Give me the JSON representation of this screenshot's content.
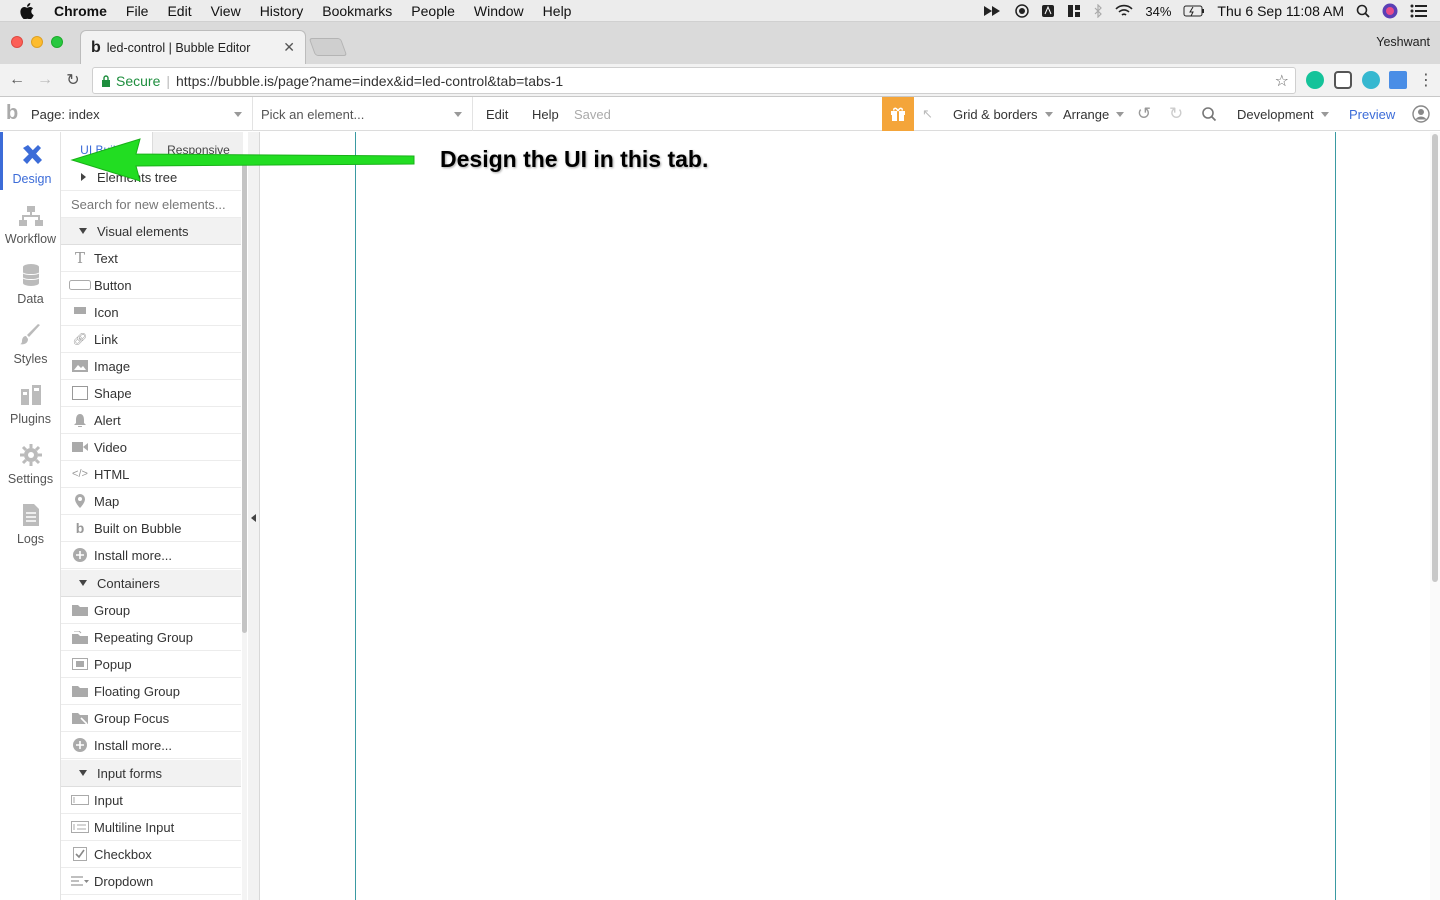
{
  "macos_menubar": {
    "app": "Chrome",
    "menus": [
      "File",
      "Edit",
      "View",
      "History",
      "Bookmarks",
      "People",
      "Window",
      "Help"
    ],
    "battery": "34%",
    "datetime": "Thu 6 Sep  11:08 AM"
  },
  "browser": {
    "tab_title": "led-control | Bubble Editor",
    "tab_favicon": "b",
    "profile_name": "Yeshwant",
    "secure_label": "Secure",
    "url": "https://bubble.is/page?name=index&id=led-control&tab=tabs-1",
    "colors": {
      "secure_green": "#1e8e3e"
    }
  },
  "editor_topbar": {
    "page_selector": "Page: index",
    "element_picker": "Pick an element...",
    "edit": "Edit",
    "help": "Help",
    "status": "Saved",
    "grid_borders": "Grid & borders",
    "arrange": "Arrange",
    "environment": "Development",
    "preview": "Preview",
    "colors": {
      "gift_bg": "#f4a53a",
      "preview": "#3c6cd8"
    }
  },
  "left_nav": {
    "items": [
      {
        "label": "Design",
        "icon": "design-icon",
        "active": true
      },
      {
        "label": "Workflow",
        "icon": "workflow-icon"
      },
      {
        "label": "Data",
        "icon": "database-icon"
      },
      {
        "label": "Styles",
        "icon": "brush-icon"
      },
      {
        "label": "Plugins",
        "icon": "plugin-icon"
      },
      {
        "label": "Settings",
        "icon": "gear-icon"
      },
      {
        "label": "Logs",
        "icon": "document-icon"
      }
    ]
  },
  "palette": {
    "tabs": [
      "UI Builder",
      "Responsive"
    ],
    "elements_tree": "Elements tree",
    "search_placeholder": "Search for new elements...",
    "sections": [
      {
        "title": "Visual elements",
        "items": [
          "Text",
          "Button",
          "Icon",
          "Link",
          "Image",
          "Shape",
          "Alert",
          "Video",
          "HTML",
          "Map",
          "Built on Bubble",
          "Install more..."
        ]
      },
      {
        "title": "Containers",
        "items": [
          "Group",
          "Repeating Group",
          "Popup",
          "Floating Group",
          "Group Focus",
          "Install more..."
        ]
      },
      {
        "title": "Input forms",
        "items": [
          "Input",
          "Multiline Input",
          "Checkbox",
          "Dropdown"
        ]
      }
    ]
  },
  "annotation": {
    "text": "Design the UI in this tab.",
    "arrow_color": "#22dd22"
  }
}
